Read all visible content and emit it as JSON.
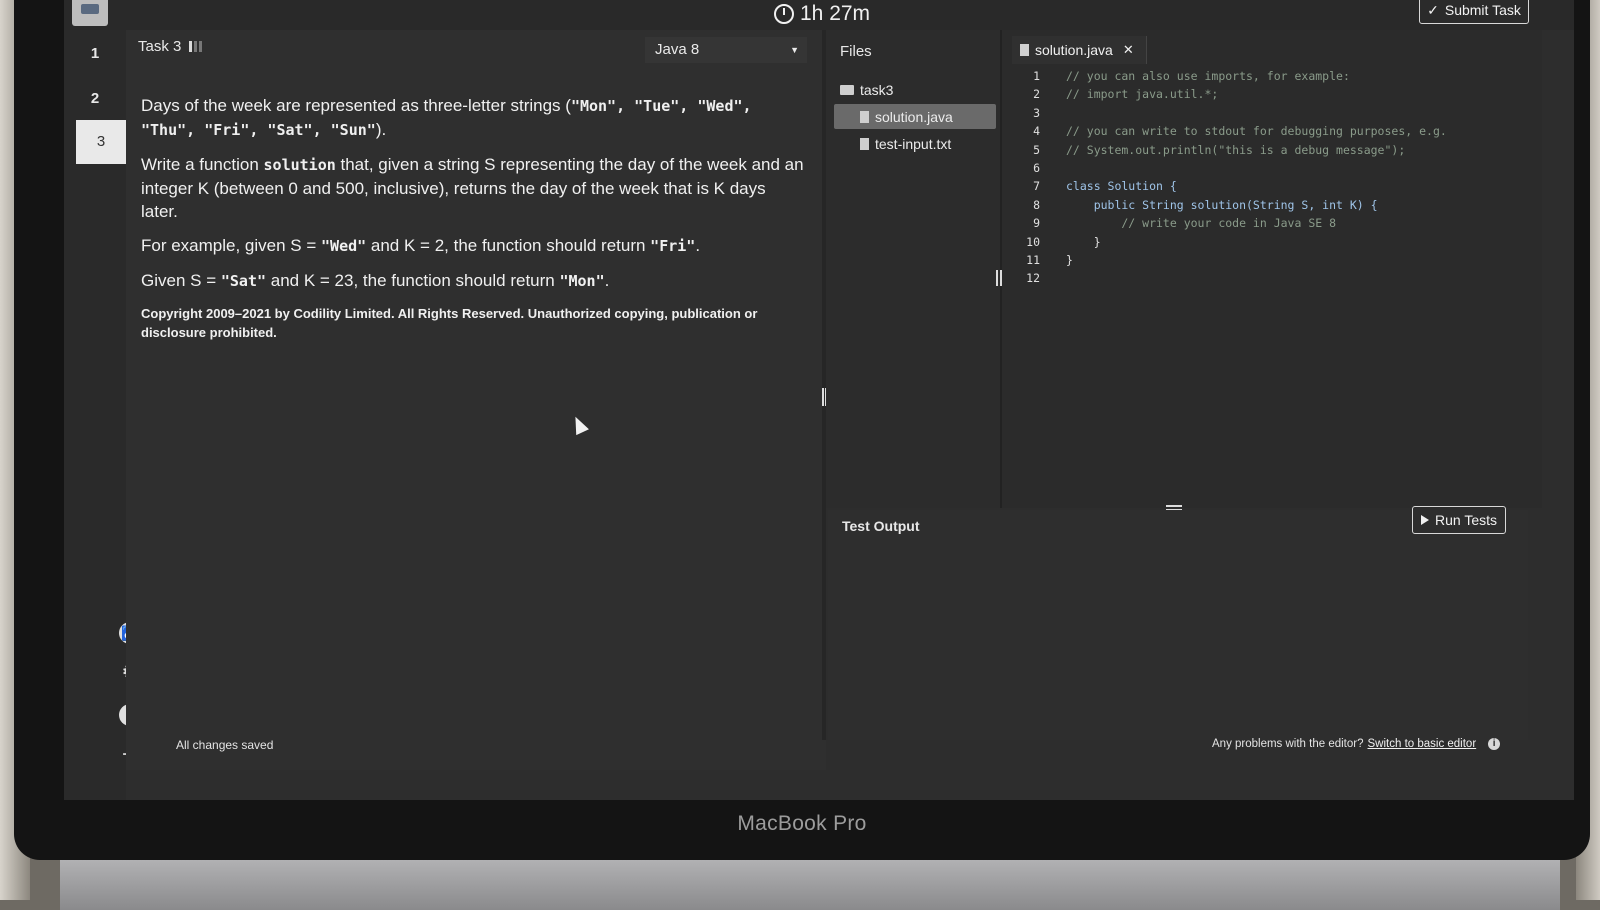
{
  "timer": "1h 27m",
  "submit_label": "Submit Task",
  "task_nav": [
    "1",
    "2",
    "3"
  ],
  "task_title": "Task 3",
  "language": "Java 8",
  "description": {
    "p1_pre": "Days of the week are represented as three-letter strings (",
    "p1_days": "\"Mon\", \"Tue\", \"Wed\", \"Thu\", \"Fri\", \"Sat\", \"Sun\"",
    "p1_post": ").",
    "p2_pre": "Write a function ",
    "p2_fn": "solution",
    "p2_post": " that, given a string S representing the day of the week and an integer K (between 0 and 500, inclusive), returns the day of the week that is K days later.",
    "p3_pre": "For example, given S = ",
    "p3_s": "\"Wed\"",
    "p3_mid": " and K = 2, the function should return ",
    "p3_ret": "\"Fri\"",
    "p3_post": ".",
    "p4_pre": "Given S = ",
    "p4_s": "\"Sat\"",
    "p4_mid": " and K = 23, the function should return ",
    "p4_ret": "\"Mon\"",
    "p4_post": ".",
    "copyright": "Copyright 2009–2021 by Codility Limited. All Rights Reserved. Unauthorized copying, publication or disclosure prohibited."
  },
  "files": {
    "header": "Files",
    "folder": "task3",
    "items": [
      "solution.java",
      "test-input.txt"
    ]
  },
  "editor": {
    "tab": "solution.java",
    "lines": [
      {
        "n": "1",
        "text": "// you can also use imports, for example:"
      },
      {
        "n": "2",
        "text": "// import java.util.*;"
      },
      {
        "n": "3",
        "text": ""
      },
      {
        "n": "4",
        "text": "// you can write to stdout for debugging purposes, e.g."
      },
      {
        "n": "5",
        "text": "// System.out.println(\"this is a debug message\");"
      },
      {
        "n": "6",
        "text": ""
      },
      {
        "n": "7",
        "text": "class Solution {"
      },
      {
        "n": "8",
        "text": "    public String solution(String S, int K) {"
      },
      {
        "n": "9",
        "text": "        // write your code in Java SE 8"
      },
      {
        "n": "10",
        "text": "    }"
      },
      {
        "n": "11",
        "text": "}"
      },
      {
        "n": "12",
        "text": ""
      }
    ]
  },
  "output": {
    "header": "Test Output",
    "run_label": "Run Tests"
  },
  "footer": {
    "status": "All changes saved",
    "problems_text": "Any problems with the editor?",
    "switch_link": "Switch to basic editor",
    "info_icon": "i"
  },
  "device_label": "MacBook Pro",
  "icons": {
    "accessibility": "♿",
    "settings": "⚙",
    "help": "?",
    "logout": "⇥"
  }
}
